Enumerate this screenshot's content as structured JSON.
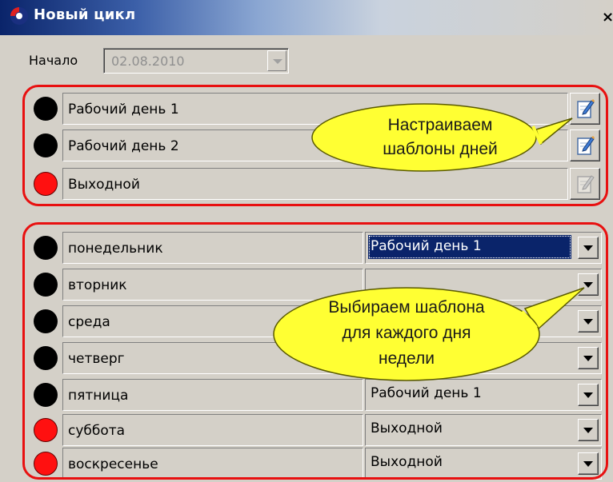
{
  "window": {
    "title": "Новый цикл",
    "close_label": "×"
  },
  "start": {
    "label": "Начало",
    "date_value": "02.08.2010"
  },
  "templates": [
    {
      "name": "Рабочий день 1",
      "dot_color": "#000000",
      "edit_enabled": true
    },
    {
      "name": "Рабочий день 2",
      "dot_color": "#000000",
      "edit_enabled": true
    },
    {
      "name": "Выходной",
      "dot_color": "#ff1010",
      "edit_enabled": false
    }
  ],
  "days": [
    {
      "name": "понедельник",
      "template": "Рабочий день 1",
      "dot_color": "#000000",
      "selected": true
    },
    {
      "name": "вторник",
      "template": "",
      "dot_color": "#000000"
    },
    {
      "name": "среда",
      "template": "",
      "dot_color": "#000000"
    },
    {
      "name": "четверг",
      "template": "",
      "dot_color": "#000000"
    },
    {
      "name": "пятница",
      "template": "Рабочий день 1",
      "dot_color": "#000000"
    },
    {
      "name": "суббота",
      "template": "Выходной",
      "dot_color": "#ff1010"
    },
    {
      "name": "воскресенье",
      "template": "Выходной",
      "dot_color": "#ff1010"
    }
  ],
  "callouts": {
    "templates": {
      "line1": "Настраиваем",
      "line2": "шаблоны дней"
    },
    "days": {
      "line1": "Выбираем шаблона",
      "line2": "для каждого дня",
      "line3": "недели"
    }
  },
  "colors": {
    "highlight_outline": "#e81010",
    "callout_fill": "#ffff33",
    "selection": "#0a246a"
  }
}
